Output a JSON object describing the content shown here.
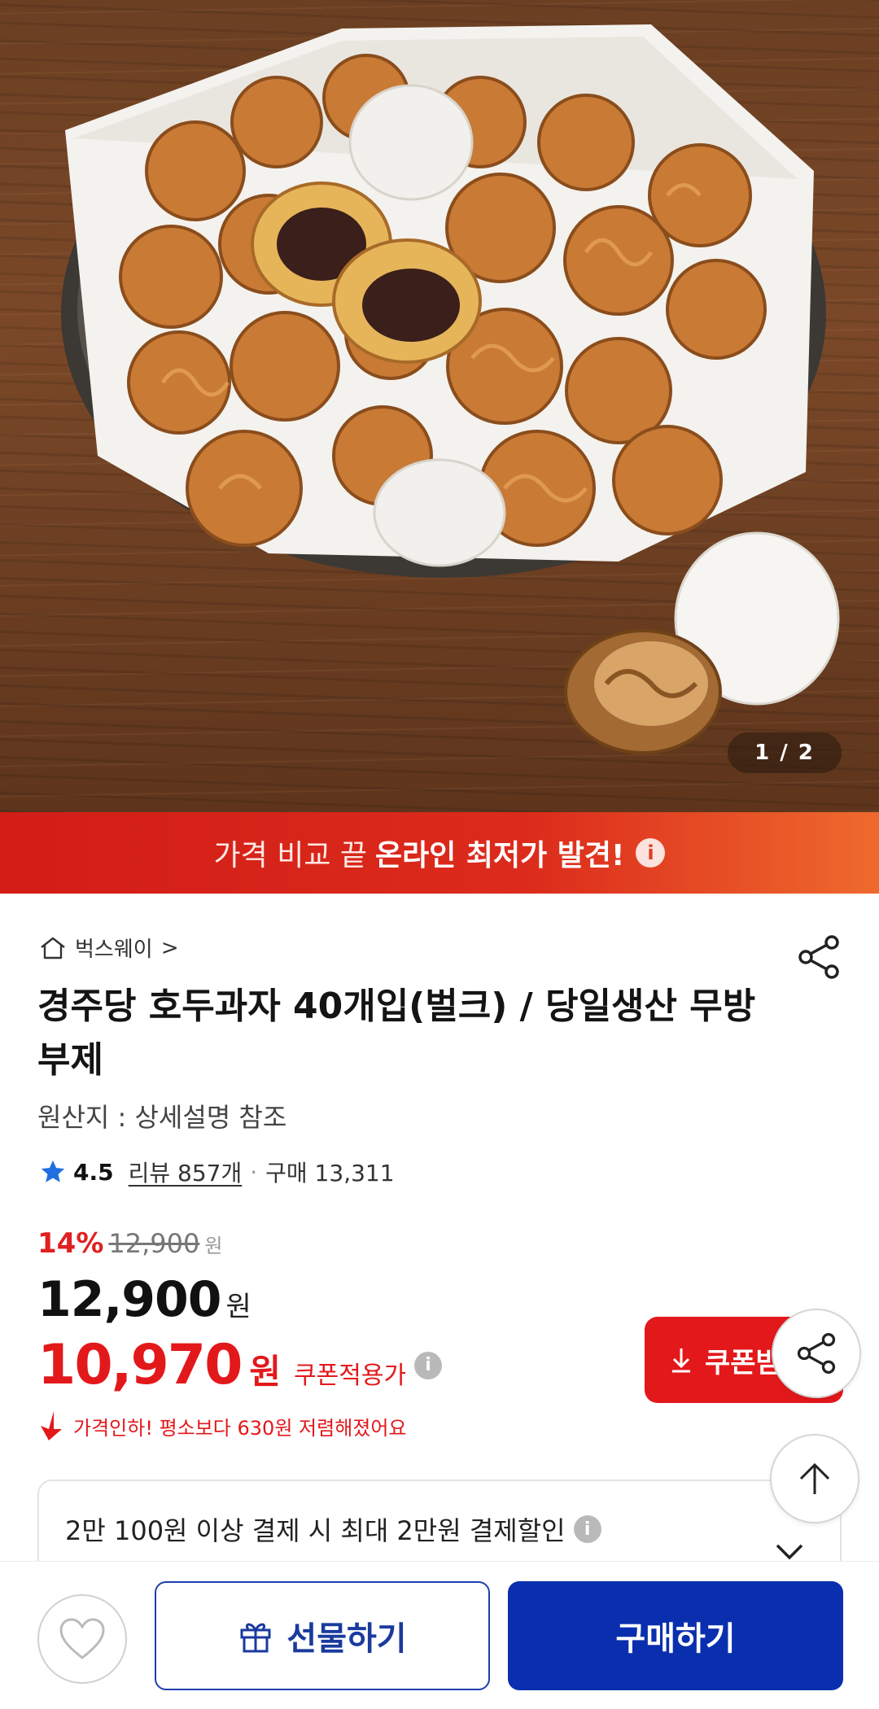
{
  "hero": {
    "counter": "1 / 2"
  },
  "promo": {
    "text_normal": "가격 비교 끝",
    "text_bold": "온라인 최저가 발견!",
    "info_icon": "info-icon"
  },
  "product": {
    "seller": "벅스웨이",
    "seller_arrow": ">",
    "title": "경주당 호두과자 40개입(벌크) / 당일생산 무방부제",
    "origin": "원산지 : 상세설명 참조",
    "rating": "4.5",
    "review": "리뷰 857개",
    "separator": "·",
    "purchases": "구매 13,311"
  },
  "price": {
    "discount_rate": "14%",
    "original": "12,900",
    "original_unit": "원",
    "current": "12,900",
    "current_unit": "원",
    "coupon_price": "10,970",
    "coupon_unit": "원",
    "coupon_label": "쿠폰적용가",
    "drop_note": "가격인하! 평소보다 630원 저렴해졌어요",
    "info_icon": "i"
  },
  "coupon_button": {
    "label": "쿠폰받"
  },
  "benefit": {
    "text": "2만 100원 이상 결제 시 최대 2만원 결제할인"
  },
  "bottom_bar": {
    "gift_label": "선물하기",
    "buy_label": "구매하기"
  },
  "colors": {
    "accent_red": "#e3181b",
    "brand_blue": "#0a2fae",
    "promo_start": "#d21d17",
    "promo_end": "#ee6a2d"
  }
}
